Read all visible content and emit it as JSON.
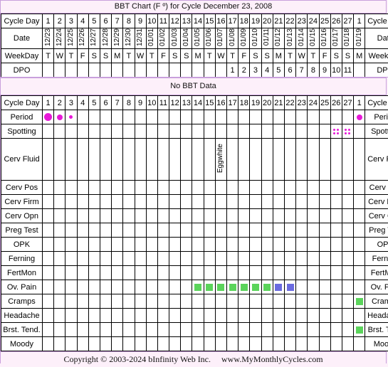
{
  "chart": {
    "title": "BBT Chart (F º) for Cycle December 23, 2008",
    "no_bbt_text": "No BBT Data",
    "footer_copyright": "Copyright © 2003-2024 bInfinity Web Inc.",
    "footer_site": "www.MyMonthlyCycles.com"
  },
  "colors": {
    "frame_border": "#c9a0dc",
    "panel_bg": "#fdf0fa",
    "header_bg": "#ececec",
    "date_bg": "#fbf8ec",
    "period_marker": "#e818d8",
    "spotting_marker": "#e818d8",
    "symptom_green": "#5bd45b",
    "symptom_blue": "#6b6be0"
  },
  "labels": {
    "cycle_day": "Cycle Day",
    "date": "Date",
    "weekday": "WeekDay",
    "dpo": "DPO",
    "period": "Period",
    "spotting": "Spotting",
    "cerv_fluid": "Cerv Fluid",
    "cerv_pos": "Cerv Pos",
    "cerv_firm": "Cerv Firm",
    "cerv_opn": "Cerv Opn",
    "preg_test": "Preg Test",
    "opk": "OPK",
    "ferning": "Ferning",
    "fertmon": "FertMon",
    "ov_pain": "Ov. Pain",
    "cramps": "Cramps",
    "headache": "Headache",
    "brst_tend_left": "Brst. Tend.",
    "brst_tend_right": "Brst. Tend",
    "moody": "Moody"
  },
  "chart_data": {
    "type": "table",
    "title": "BBT Chart (F º) for Cycle December 23, 2008",
    "cycle_start_date": "December 23, 2008",
    "num_columns": 28,
    "cycle_days": [
      "1",
      "2",
      "3",
      "4",
      "5",
      "6",
      "7",
      "8",
      "9",
      "10",
      "11",
      "12",
      "13",
      "14",
      "15",
      "16",
      "17",
      "18",
      "19",
      "20",
      "21",
      "22",
      "23",
      "24",
      "25",
      "26",
      "27",
      "1"
    ],
    "dates": [
      "12/23",
      "12/24",
      "12/25",
      "12/26",
      "12/27",
      "12/28",
      "12/29",
      "12/30",
      "12/31",
      "01/01",
      "01/02",
      "01/03",
      "01/04",
      "01/05",
      "01/06",
      "01/07",
      "01/08",
      "01/09",
      "01/10",
      "01/11",
      "01/12",
      "01/13",
      "01/14",
      "01/15",
      "01/16",
      "01/17",
      "01/18",
      "01/19"
    ],
    "weekdays": [
      "T",
      "W",
      "T",
      "F",
      "S",
      "S",
      "M",
      "T",
      "W",
      "T",
      "F",
      "S",
      "S",
      "M",
      "T",
      "W",
      "T",
      "F",
      "S",
      "S",
      "M",
      "T",
      "W",
      "T",
      "F",
      "S",
      "S",
      "M"
    ],
    "dpo": [
      "",
      "",
      "",
      "",
      "",
      "",
      "",
      "",
      "",
      "",
      "",
      "",
      "",
      "",
      "",
      "",
      "1",
      "2",
      "3",
      "4",
      "5",
      "6",
      "7",
      "8",
      "9",
      "10",
      "11",
      ""
    ],
    "period": [
      "heavy",
      "med",
      "light",
      "",
      "",
      "",
      "",
      "",
      "",
      "",
      "",
      "",
      "",
      "",
      "",
      "",
      "",
      "",
      "",
      "",
      "",
      "",
      "",
      "",
      "",
      "",
      "",
      "med"
    ],
    "spotting": [
      "",
      "",
      "",
      "",
      "",
      "",
      "",
      "",
      "",
      "",
      "",
      "",
      "",
      "",
      "",
      "",
      "",
      "",
      "",
      "",
      "",
      "",
      "",
      "",
      "",
      "spot",
      "spot",
      ""
    ],
    "cerv_fluid": [
      "",
      "",
      "",
      "",
      "",
      "",
      "",
      "",
      "",
      "",
      "",
      "",
      "",
      "",
      "",
      "Eggwhite",
      "",
      "",
      "",
      "",
      "",
      "",
      "",
      "",
      "",
      "",
      "",
      ""
    ],
    "cerv_pos": [
      "",
      "",
      "",
      "",
      "",
      "",
      "",
      "",
      "",
      "",
      "",
      "",
      "",
      "",
      "",
      "",
      "",
      "",
      "",
      "",
      "",
      "",
      "",
      "",
      "",
      "",
      "",
      ""
    ],
    "cerv_firm": [
      "",
      "",
      "",
      "",
      "",
      "",
      "",
      "",
      "",
      "",
      "",
      "",
      "",
      "",
      "",
      "",
      "",
      "",
      "",
      "",
      "",
      "",
      "",
      "",
      "",
      "",
      "",
      ""
    ],
    "cerv_opn": [
      "",
      "",
      "",
      "",
      "",
      "",
      "",
      "",
      "",
      "",
      "",
      "",
      "",
      "",
      "",
      "",
      "",
      "",
      "",
      "",
      "",
      "",
      "",
      "",
      "",
      "",
      "",
      ""
    ],
    "preg_test": [
      "",
      "",
      "",
      "",
      "",
      "",
      "",
      "",
      "",
      "",
      "",
      "",
      "",
      "",
      "",
      "",
      "",
      "",
      "",
      "",
      "",
      "",
      "",
      "",
      "",
      "",
      "",
      ""
    ],
    "opk": [
      "",
      "",
      "",
      "",
      "",
      "",
      "",
      "",
      "",
      "",
      "",
      "",
      "",
      "",
      "",
      "",
      "",
      "",
      "",
      "",
      "",
      "",
      "",
      "",
      "",
      "",
      "",
      ""
    ],
    "ferning": [
      "",
      "",
      "",
      "",
      "",
      "",
      "",
      "",
      "",
      "",
      "",
      "",
      "",
      "",
      "",
      "",
      "",
      "",
      "",
      "",
      "",
      "",
      "",
      "",
      "",
      "",
      "",
      ""
    ],
    "fertmon": [
      "",
      "",
      "",
      "",
      "",
      "",
      "",
      "",
      "",
      "",
      "",
      "",
      "",
      "",
      "",
      "",
      "",
      "",
      "",
      "",
      "",
      "",
      "",
      "",
      "",
      "",
      "",
      ""
    ],
    "ov_pain": [
      "",
      "",
      "",
      "",
      "",
      "",
      "",
      "",
      "",
      "",
      "",
      "",
      "",
      "green",
      "green",
      "green",
      "green",
      "green",
      "green",
      "green",
      "blue",
      "blue",
      "",
      "",
      "",
      "",
      "",
      ""
    ],
    "cramps": [
      "",
      "",
      "",
      "",
      "",
      "",
      "",
      "",
      "",
      "",
      "",
      "",
      "",
      "",
      "",
      "",
      "",
      "",
      "",
      "",
      "",
      "",
      "",
      "",
      "",
      "",
      "",
      "green"
    ],
    "headache": [
      "",
      "",
      "",
      "",
      "",
      "",
      "",
      "",
      "",
      "",
      "",
      "",
      "",
      "",
      "",
      "",
      "",
      "",
      "",
      "",
      "",
      "",
      "",
      "",
      "",
      "",
      "",
      ""
    ],
    "brst_tend": [
      "",
      "",
      "",
      "",
      "",
      "",
      "",
      "",
      "",
      "",
      "",
      "",
      "",
      "",
      "",
      "",
      "",
      "",
      "",
      "",
      "",
      "",
      "",
      "",
      "",
      "",
      "",
      "green"
    ],
    "moody": [
      "",
      "",
      "",
      "",
      "",
      "",
      "",
      "",
      "",
      "",
      "",
      "",
      "",
      "",
      "",
      "",
      "",
      "",
      "",
      "",
      "",
      "",
      "",
      "",
      "",
      "",
      "",
      ""
    ]
  }
}
